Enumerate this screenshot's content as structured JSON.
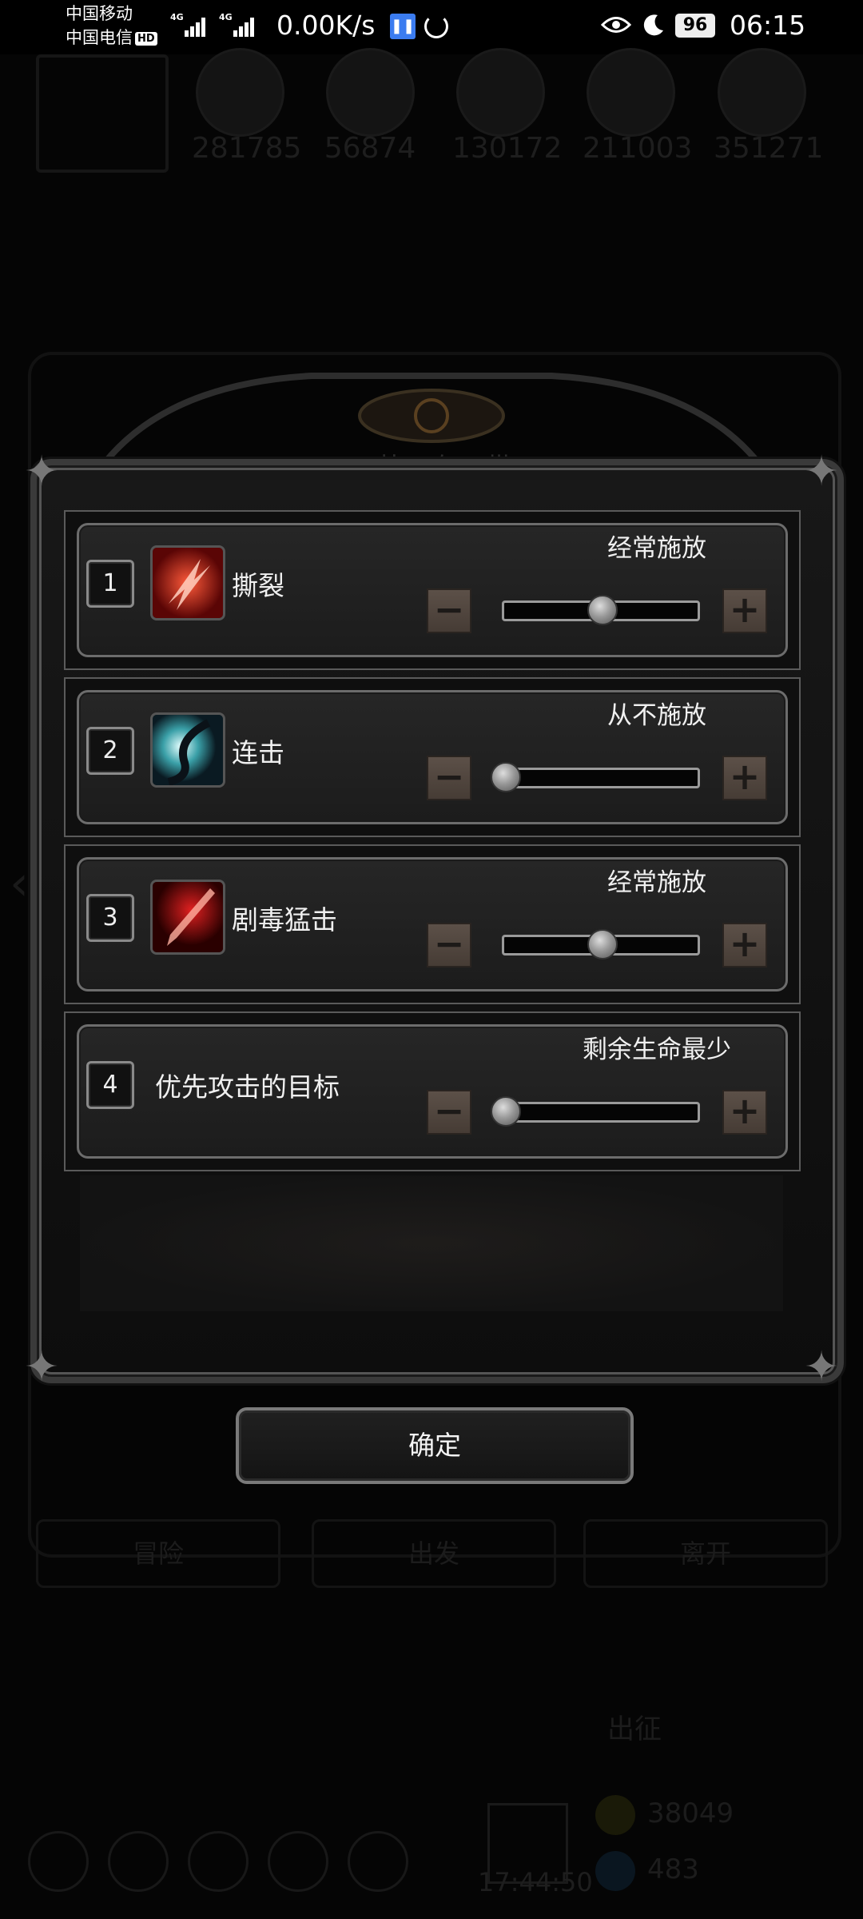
{
  "status_bar": {
    "carrier_1": "中国移动",
    "carrier_2": "中国电信",
    "hd_badge": "HD",
    "network_1": "4G",
    "network_2": "4G",
    "net_speed": "0.00K/s",
    "battery": "96",
    "time": "06:15"
  },
  "background": {
    "resources": [
      "281785",
      "56874",
      "130172",
      "211003",
      "351271"
    ],
    "panel_title": "革 布 带",
    "bottom_buttons": [
      "冒险",
      "出发",
      "离开"
    ],
    "expedition_label": "出征",
    "coin_1": "38049",
    "coin_2": "483",
    "clock": "17:44:50"
  },
  "dialog": {
    "rows": [
      {
        "index": "1",
        "name": "撕裂",
        "setting": "经常施放",
        "level": 0.5,
        "icon": "tear-skill-icon"
      },
      {
        "index": "2",
        "name": "连击",
        "setting": "从不施放",
        "level": 0.0,
        "icon": "combo-skill-icon"
      },
      {
        "index": "3",
        "name": "剧毒猛击",
        "setting": "经常施放",
        "level": 0.5,
        "icon": "poison-strike-skill-icon"
      },
      {
        "index": "4",
        "name": "优先攻击的目标",
        "setting": "剩余生命最少",
        "level": 0.0,
        "icon": null
      }
    ],
    "minus_label": "−",
    "plus_label": "+",
    "confirm_label": "确定"
  },
  "colors": {
    "background": "#050505",
    "panel": "#181818",
    "stepper": "#5c5048",
    "frame": "#6c6c6c"
  }
}
